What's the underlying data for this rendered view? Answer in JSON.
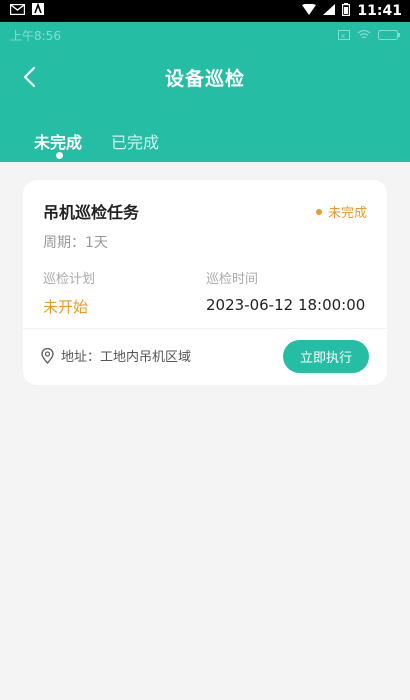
{
  "system_status": {
    "time": "11:41"
  },
  "inner_status": {
    "time": "上午8:56"
  },
  "header": {
    "title": "设备巡检"
  },
  "tabs": [
    {
      "label": "未完成",
      "active": true
    },
    {
      "label": "已完成",
      "active": false
    }
  ],
  "task": {
    "title": "吊机巡检任务",
    "status": "未完成",
    "period_label": "周期：",
    "period_value": "1天",
    "plan_label": "巡检计划",
    "plan_value": "未开始",
    "time_label": "巡检时间",
    "time_value": "2023-06-12 18:00:00",
    "address_label": "地址：",
    "address_value": "工地内吊机区域",
    "action_label": "立即执行"
  },
  "colors": {
    "primary": "#25bea5",
    "pending": "#e89a2c"
  },
  "icons": [
    "mail-icon",
    "app-icon",
    "wifi-icon",
    "signal-icon",
    "battery-icon",
    "back-arrow-icon",
    "location-pin-icon"
  ]
}
